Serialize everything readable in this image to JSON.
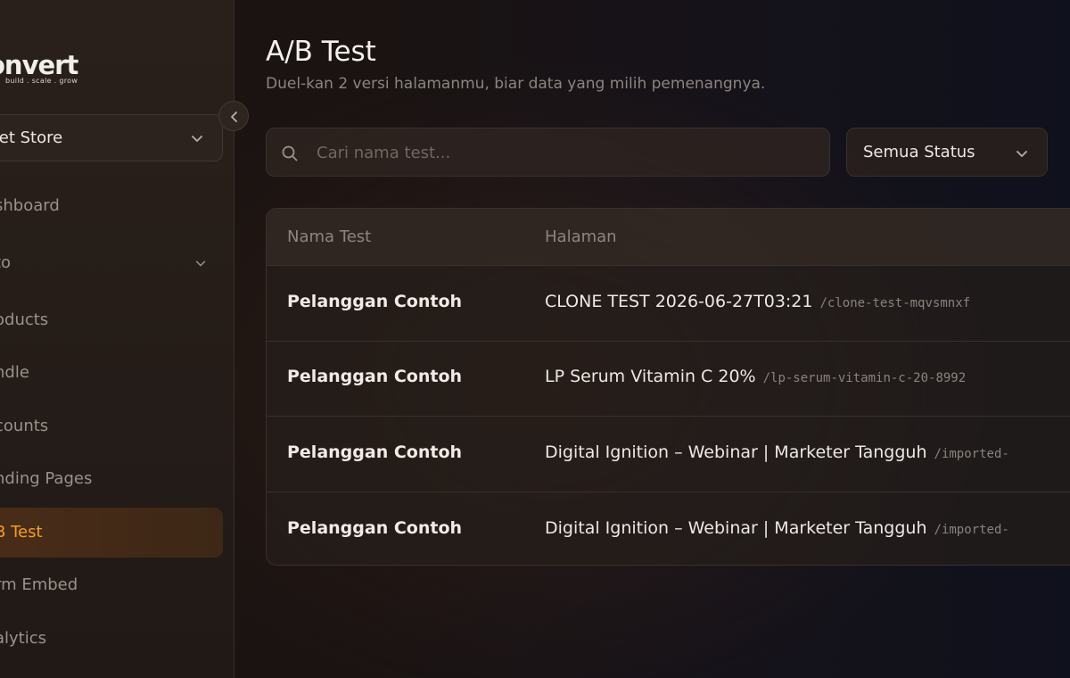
{
  "sidebar": {
    "logo_word": "onvert",
    "logo_tagline": "build . scale . grow",
    "store_name": "ket Store",
    "items": [
      {
        "label": "shboard",
        "has_chevron": false,
        "active": false
      },
      {
        "label": "to",
        "has_chevron": true,
        "active": false
      },
      {
        "label": "oducts",
        "has_chevron": false,
        "active": false
      },
      {
        "label": "ndle",
        "has_chevron": false,
        "active": false
      },
      {
        "label": "counts",
        "has_chevron": false,
        "active": false
      },
      {
        "label": "nding Pages",
        "has_chevron": false,
        "active": false
      },
      {
        "label": "B Test",
        "has_chevron": false,
        "active": true
      },
      {
        "label": "rm Embed",
        "has_chevron": false,
        "active": false
      },
      {
        "label": "alytics",
        "has_chevron": false,
        "active": false
      }
    ]
  },
  "header": {
    "title": "A/B Test",
    "subtitle": "Duel-kan 2 versi halamanmu, biar data yang milih pemenangnya."
  },
  "filters": {
    "search_placeholder": "Cari nama test...",
    "search_value": "",
    "status_selected": "Semua Status"
  },
  "table": {
    "columns": [
      "Nama Test",
      "Halaman"
    ],
    "rows": [
      {
        "name": "Pelanggan Contoh",
        "page": "CLONE TEST 2026-06-27T03:21",
        "slug": "/clone-test-mqvsmnxf"
      },
      {
        "name": "Pelanggan Contoh",
        "page": "LP Serum Vitamin C 20%",
        "slug": "/lp-serum-vitamin-c-20-8992"
      },
      {
        "name": "Pelanggan Contoh",
        "page": "Digital Ignition – Webinar | Marketer Tangguh",
        "slug": "/imported-"
      },
      {
        "name": "Pelanggan Contoh",
        "page": "Digital Ignition – Webinar | Marketer Tangguh",
        "slug": "/imported-"
      }
    ]
  },
  "colors": {
    "accent": "#f59a2e",
    "active_bg": "#4a2d18",
    "muted_text": "#8c847f"
  }
}
